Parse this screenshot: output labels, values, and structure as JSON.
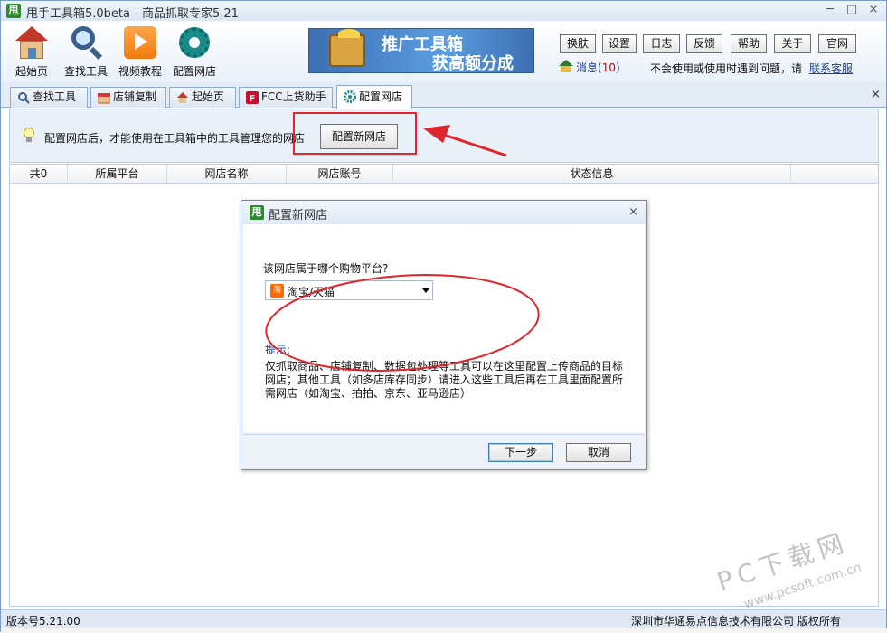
{
  "window": {
    "logo_char": "甩",
    "title": "甩手工具箱5.0beta - 商品抓取专家5.21",
    "minimize": "─",
    "maximize": "□",
    "close": "×"
  },
  "toolbar": {
    "items": [
      {
        "label": "起始页",
        "icon": "home-icon"
      },
      {
        "label": "查找工具",
        "icon": "magnifier-icon"
      },
      {
        "label": "视频教程",
        "icon": "video-play-icon"
      },
      {
        "label": "配置网店",
        "icon": "gear-icon"
      }
    ],
    "banner": {
      "line1": "推广工具箱",
      "line2": "获高额分成"
    },
    "buttons": [
      "换肤",
      "设置",
      "日志",
      "反馈",
      "帮助",
      "关于",
      "官网"
    ],
    "message_label": "消息(",
    "message_count": "10",
    "message_close": ")",
    "help_text": "不会使用或使用时遇到问题，请",
    "help_link": "联系客服"
  },
  "tabs": [
    {
      "label": "查找工具",
      "icon": "magnifier-icon",
      "active": false
    },
    {
      "label": "店铺复制",
      "icon": "shop-icon",
      "active": false
    },
    {
      "label": "起始页",
      "icon": "home-icon",
      "active": false
    },
    {
      "label": "FCC上货助手",
      "icon": "fcc-icon",
      "active": false
    },
    {
      "label": "配置网店",
      "icon": "gear-icon",
      "active": true
    }
  ],
  "tabs_close": "×",
  "infobar": {
    "text": "配置网店后，才能使用在工具箱中的工具管理您的网店",
    "button": "配置新网店"
  },
  "table": {
    "columns": [
      "共0",
      "所属平台",
      "网店名称",
      "网店账号",
      "状态信息"
    ]
  },
  "dialog": {
    "logo_char": "甩",
    "title": "配置新网店",
    "close": "×",
    "question": "该网店属于哪个购物平台?",
    "platform_icon_char": "淘",
    "platform_value": "淘宝/天猫",
    "tip_label": "提示:",
    "tip_text": "仅抓取商品、店铺复制、数据包处理等工具可以在这里配置上传商品的目标网店；其他工具（如多店库存同步）请进入这些工具后再在工具里面配置所需网店（如淘宝、拍拍、京东、亚马逊店）",
    "next_button": "下一步",
    "cancel_button": "取消"
  },
  "statusbar": {
    "version": "版本号5.21.00",
    "copyright": "深圳市华通易点信息技术有限公司 版权所有"
  },
  "watermark": {
    "main": "PC下载网",
    "sub": "www.pcsoft.com.cn"
  },
  "colors": {
    "annotation_red": "#e0262b",
    "accent_blue": "#1a3e8a"
  }
}
